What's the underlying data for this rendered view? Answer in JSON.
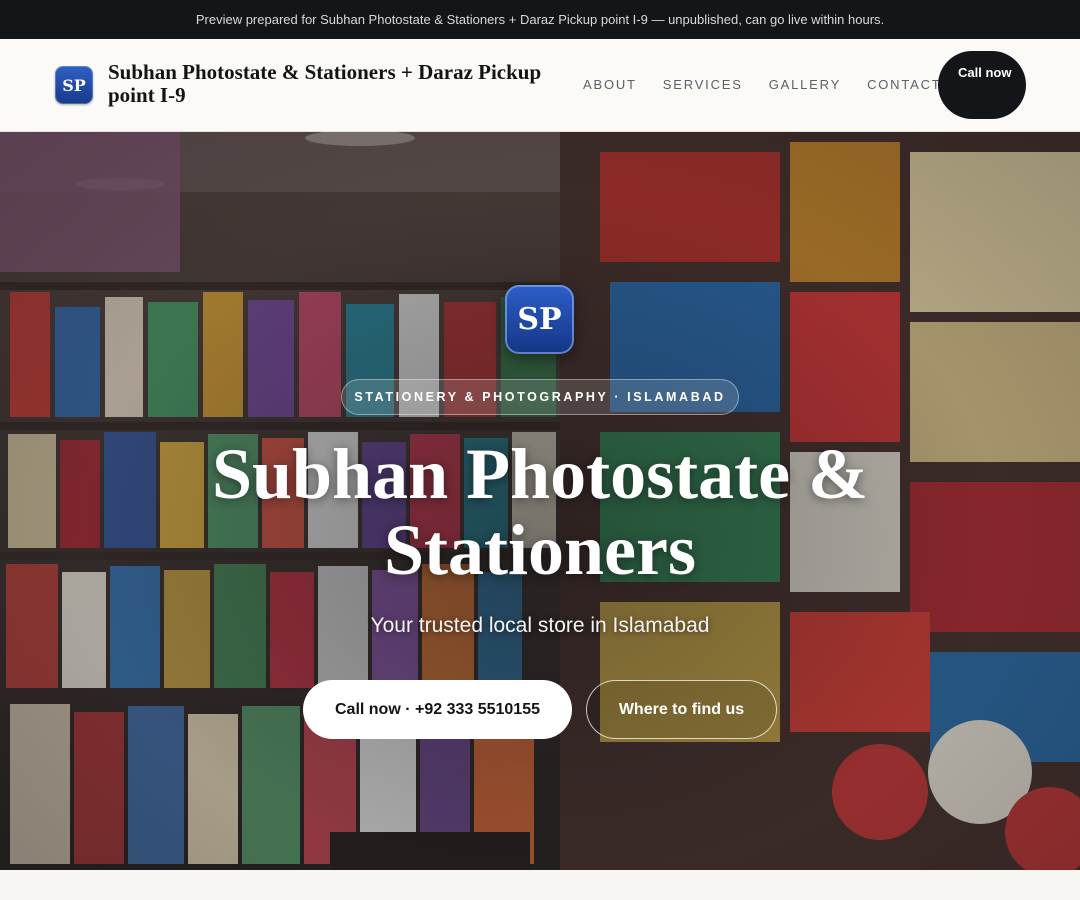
{
  "banner": {
    "text": "Preview prepared for Subhan Photostate & Stationers + Daraz Pickup point I-9 — unpublished, can go live within hours."
  },
  "header": {
    "logo_initials": "SP",
    "brand_name": "Subhan Photostate & Stationers + Daraz Pickup point I-9",
    "nav": [
      {
        "label": "ABOUT"
      },
      {
        "label": "SERVICES"
      },
      {
        "label": "GALLERY"
      },
      {
        "label": "CONTACT"
      }
    ],
    "call_label": "Call now"
  },
  "hero": {
    "logo_initials": "SP",
    "eyebrow": "STATIONERY & PHOTOGRAPHY · ISLAMABAD",
    "title": "Subhan Photostate & Stationers",
    "subtitle": "Your trusted local store in Islamabad",
    "primary_cta": "Call now · +92 333 5510155",
    "secondary_cta": "Where to find us",
    "background_image": "store-shelves-photo"
  },
  "colors": {
    "dark": "#131519",
    "brand_blue": "#1f4aa8",
    "page_bg": "#f7f6f2"
  }
}
